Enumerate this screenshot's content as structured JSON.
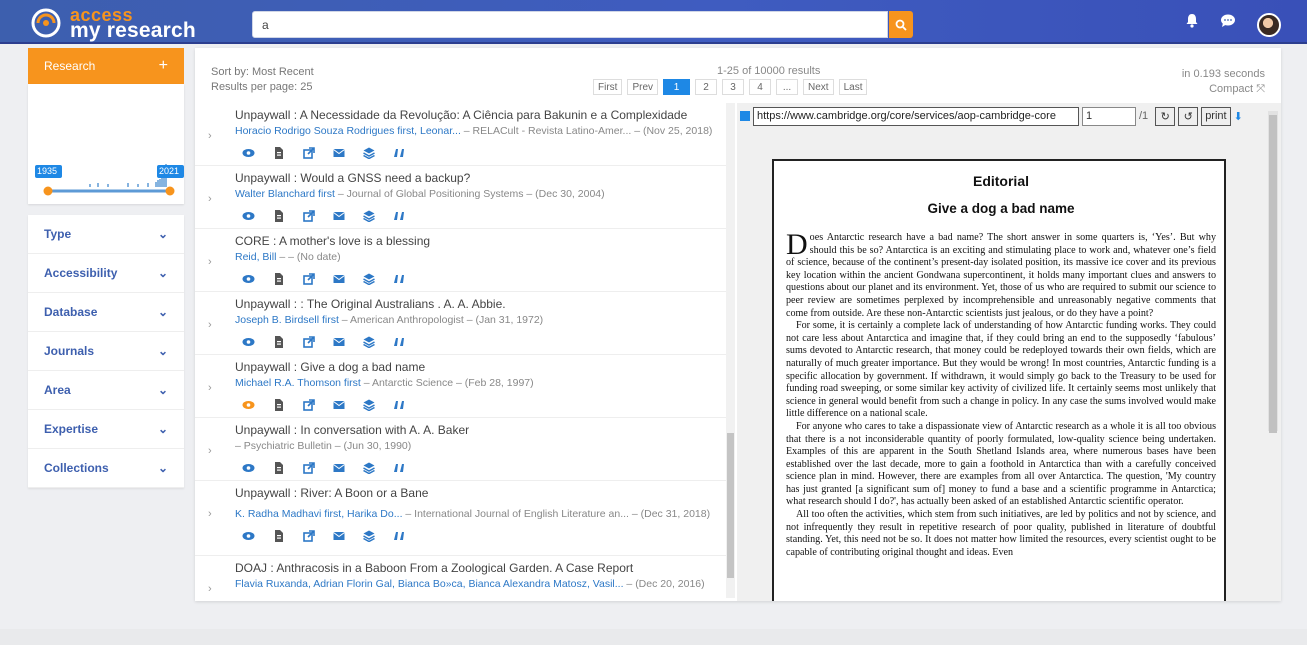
{
  "brand": {
    "line1": "access",
    "line2": "my research"
  },
  "search": {
    "value": "a"
  },
  "sidebar": {
    "research_label": "Research",
    "research_add": "+",
    "timeline": {
      "start": "1935",
      "end": "2021"
    },
    "facets": [
      "Type",
      "Accessibility",
      "Database",
      "Journals",
      "Area",
      "Expertise",
      "Collections"
    ]
  },
  "toolbar": {
    "sort_label": "Sort by: Most Recent",
    "per_page_label": "Results per page: 25",
    "results_count": "1-25 of 10000 results",
    "timing": "in 0.193 seconds",
    "compact": "Compact"
  },
  "pagination": [
    "First",
    "Prev",
    "1",
    "2",
    "3",
    "4",
    "...",
    "Next",
    "Last"
  ],
  "results": [
    {
      "title": "Unpaywall : A Necessidade da Revolução: A Ciência para Bakunin e a Complexidade",
      "authors": "Horacio Rodrigo Souza Rodrigues first, Leonar...",
      "meta": " – RELACult - Revista Latino-Amer...  – (Nov 25, 2018)"
    },
    {
      "title": "Unpaywall : Would a GNSS need a backup?",
      "authors": "Walter Blanchard first",
      "meta": " – Journal of Global Positioning Systems  – (Dec 30, 2004)"
    },
    {
      "title": "CORE : A mother's love is a blessing",
      "authors": "Reid, Bill",
      "meta": " –  – (No date)"
    },
    {
      "title": "Unpaywall : : The Original Australians . A. A. Abbie.",
      "authors": "Joseph B. Birdsell first",
      "meta": " – American Anthropologist  – (Jan 31, 1972)"
    },
    {
      "title": "Unpaywall : Give a dog a bad name",
      "authors": "Michael R.A. Thomson first",
      "meta": " – Antarctic Science  – (Feb 28, 1997)"
    },
    {
      "title": "Unpaywall : In conversation with A. A. Baker",
      "authors": "",
      "meta": " – Psychiatric Bulletin  – (Jun 30, 1990)"
    },
    {
      "title": "Unpaywall : River: A Boon or a Bane",
      "authors": "K. Radha Madhavi first, Harika Do...",
      "meta": " – International Journal of English Literature an...  – (Dec 31, 2018)"
    },
    {
      "title": "DOAJ : Anthracosis in a Baboon From a Zoological Garden. A Case Report",
      "authors": "Flavia Ruxanda, Adrian Florin Gal, Bianca Bo»ca, Bianca Alexandra Matosz, Vasil...",
      "meta": " – (Dec 20, 2016)"
    }
  ],
  "viewer": {
    "url": "https://www.cambridge.org/core/services/aop-cambridge-core",
    "page": "1",
    "total": "/1",
    "print": "print",
    "doc": {
      "heading": "Editorial",
      "title": "Give a dog a bad name",
      "dropcap": "D",
      "p1": "oes Antarctic research have a bad name? The short answer in some quarters is, ‘Yes’. But why should this be so? Antarctica is an exciting and stimulating place to work and, whatever one’s field of science, because of the continent’s present-day isolated position, its massive ice cover and its previous key location within the ancient Gondwana supercontinent, it holds many important clues and answers to questions about our planet and its environment. Yet, those of us who are required to submit our science to peer review are sometimes perplexed by incomprehensible and unreasonably negative comments that come from outside. Are these non-Antarctic scientists just jealous, or do they have a point?",
      "p2": "For some, it is certainly a complete lack of understanding of how Antarctic funding works. They could not care less about Antarctica and imagine that, if they could bring an end to the supposedly ‘fabulous’ sums devoted to Antarctic research, that money could be redeployed towards their own fields, which are naturally of much greater importance. But they would be wrong! In most countries, Antarctic funding is a specific allocation by government. If withdrawn, it would simply go back to the Treasury to be used for funding road sweeping, or some similar key activity of civilized life. It certainly seems most unlikely that science in general would benefit from such a change in policy. In any case the sums involved would make little difference on a national scale.",
      "p3": "For anyone who cares to take a dispassionate view of Antarctic research as a whole it is all too obvious that there is a not inconsiderable quantity of poorly formulated, low-quality science being undertaken. Examples of this are apparent in the South Shetland Islands area, where numerous bases have been established over the last decade, more to gain a foothold in Antarctica than with a carefully conceived science plan in mind. However, there are examples from all over Antarctica. The question, 'My country has just granted [a significant sum of] money to fund a base and a scientific programme in Antarctica; what research should I do?', has actually been asked of an established Antarctic scientific operator.",
      "p4": "All too often the activities, which stem from such initiatives, are led by politics and not by science, and not infrequently they result in repetitive research of poor quality, published in literature of doubtful standing. Yet, this need not be so. It does not matter how limited the resources, every scientist ought to be capable of contributing original thought and ideas. Even"
    }
  },
  "colors": {
    "brand_blue": "#3d5fae",
    "accent_orange": "#f7941d",
    "link_blue": "#2d78c6"
  }
}
